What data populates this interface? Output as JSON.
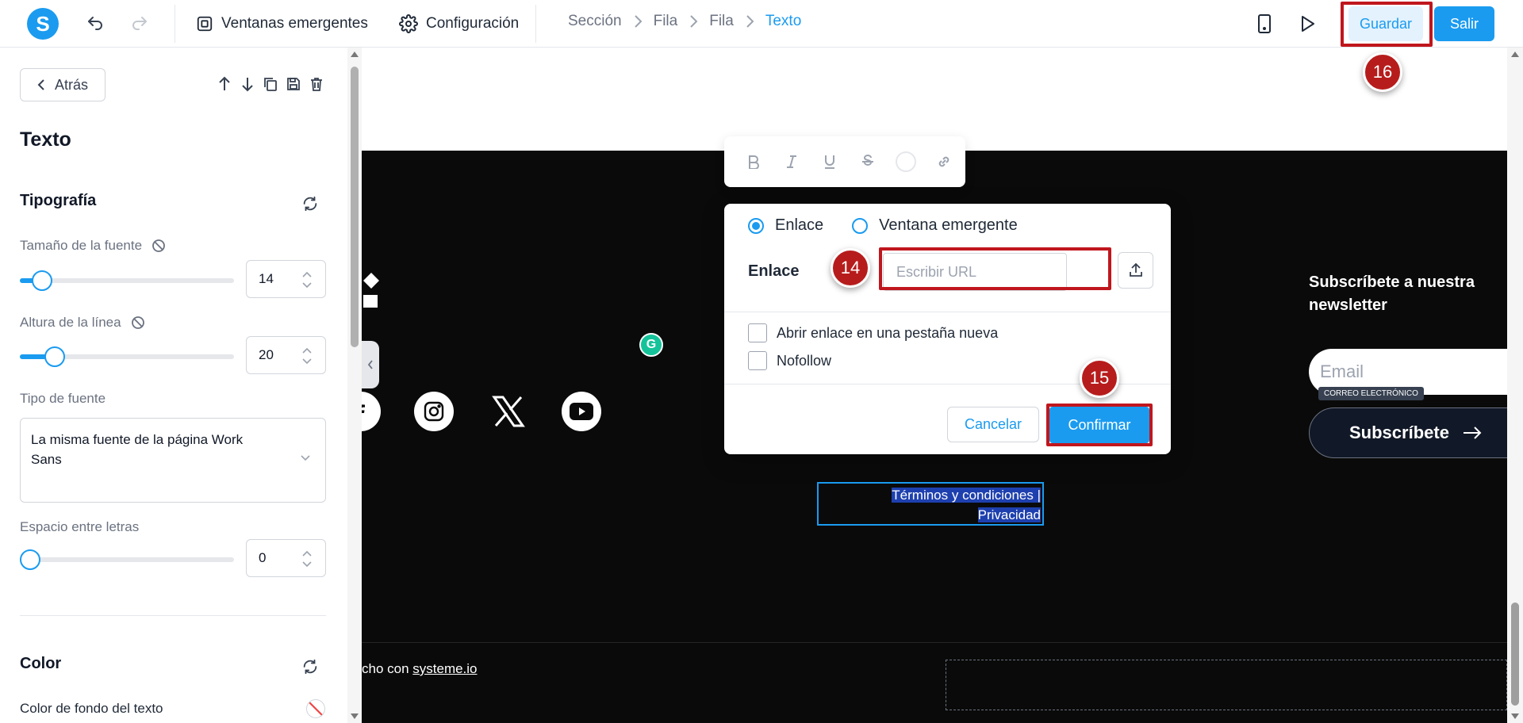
{
  "app": {
    "logo_letter": "S"
  },
  "toolbar": {
    "popups_label": "Ventanas emergentes",
    "settings_label": "Configuración",
    "save_label": "Guardar",
    "exit_label": "Salir"
  },
  "breadcrumb": [
    "Sección",
    "Fila",
    "Fila",
    "Texto"
  ],
  "sidebar": {
    "back_label": "Atrás",
    "title": "Texto",
    "typography": {
      "title": "Tipografía",
      "font_size_label": "Tamaño de la fuente",
      "font_size_value": "14",
      "line_height_label": "Altura de la línea",
      "line_height_value": "20",
      "font_type_label": "Tipo de fuente",
      "font_type_value": "La misma fuente de la página Work Sans",
      "letter_spacing_label": "Espacio entre letras",
      "letter_spacing_value": "0"
    },
    "color": {
      "title": "Color",
      "bg_label": "Color de fondo del texto"
    }
  },
  "link_dialog": {
    "option_link": "Enlace",
    "option_popup": "Ventana emergente",
    "link_label": "Enlace",
    "url_placeholder": "Escribir URL",
    "new_tab_label": "Abrir enlace en una pestaña nueva",
    "nofollow_label": "Nofollow",
    "cancel_label": "Cancelar",
    "confirm_label": "Confirmar"
  },
  "page": {
    "newsletter_title": "Subscríbete a nuestra newsletter",
    "email_placeholder": "Email",
    "email_tag": "CORREO ELECTRÓNICO",
    "subscribe_label": "Subscríbete",
    "legal_line1": "Términos y condiciones |",
    "legal_line2": "Privacidad",
    "footer_prefix": "cho con ",
    "footer_link": "systeme.io",
    "grammarly_letter": "G"
  },
  "annotations": {
    "step_14": "14",
    "step_15": "15",
    "step_16": "16"
  },
  "colors": {
    "accent": "#1a9bf0",
    "highlight": "#c0161d",
    "marker": "#b71c1c",
    "dark_bg": "#0a0a0a"
  }
}
